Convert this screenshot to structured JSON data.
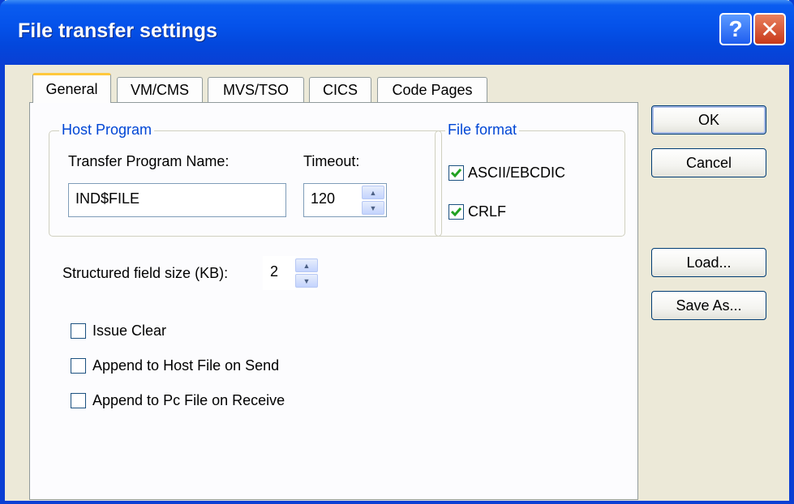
{
  "window": {
    "title": "File transfer settings"
  },
  "titlebar": {
    "help_glyph": "?",
    "close_glyph": "✕"
  },
  "tabs": [
    {
      "label": "General",
      "active": true
    },
    {
      "label": "VM/CMS",
      "active": false
    },
    {
      "label": "MVS/TSO",
      "active": false
    },
    {
      "label": "CICS",
      "active": false
    },
    {
      "label": "Code Pages",
      "active": false
    }
  ],
  "host_program": {
    "label": "Host Program",
    "program_name_label": "Transfer Program Name:",
    "program_name_value": "IND$FILE",
    "timeout_label": "Timeout:",
    "timeout_value": "120"
  },
  "file_format": {
    "label": "File format",
    "ascii_label": "ASCII/EBCDIC",
    "ascii_checked": true,
    "crlf_label": "CRLF",
    "crlf_checked": true
  },
  "structured": {
    "label": "Structured field size (KB):",
    "value": "2"
  },
  "options": {
    "issue_clear": "Issue Clear",
    "append_host": "Append  to Host File on Send",
    "append_pc": "Append  to Pc File on Receive"
  },
  "buttons": {
    "ok": "OK",
    "cancel": "Cancel",
    "load": "Load...",
    "save_as": "Save As..."
  },
  "colors": {
    "title_blue": "#0a3fd4",
    "group_label": "#0046d5",
    "check_green": "#21a121"
  }
}
